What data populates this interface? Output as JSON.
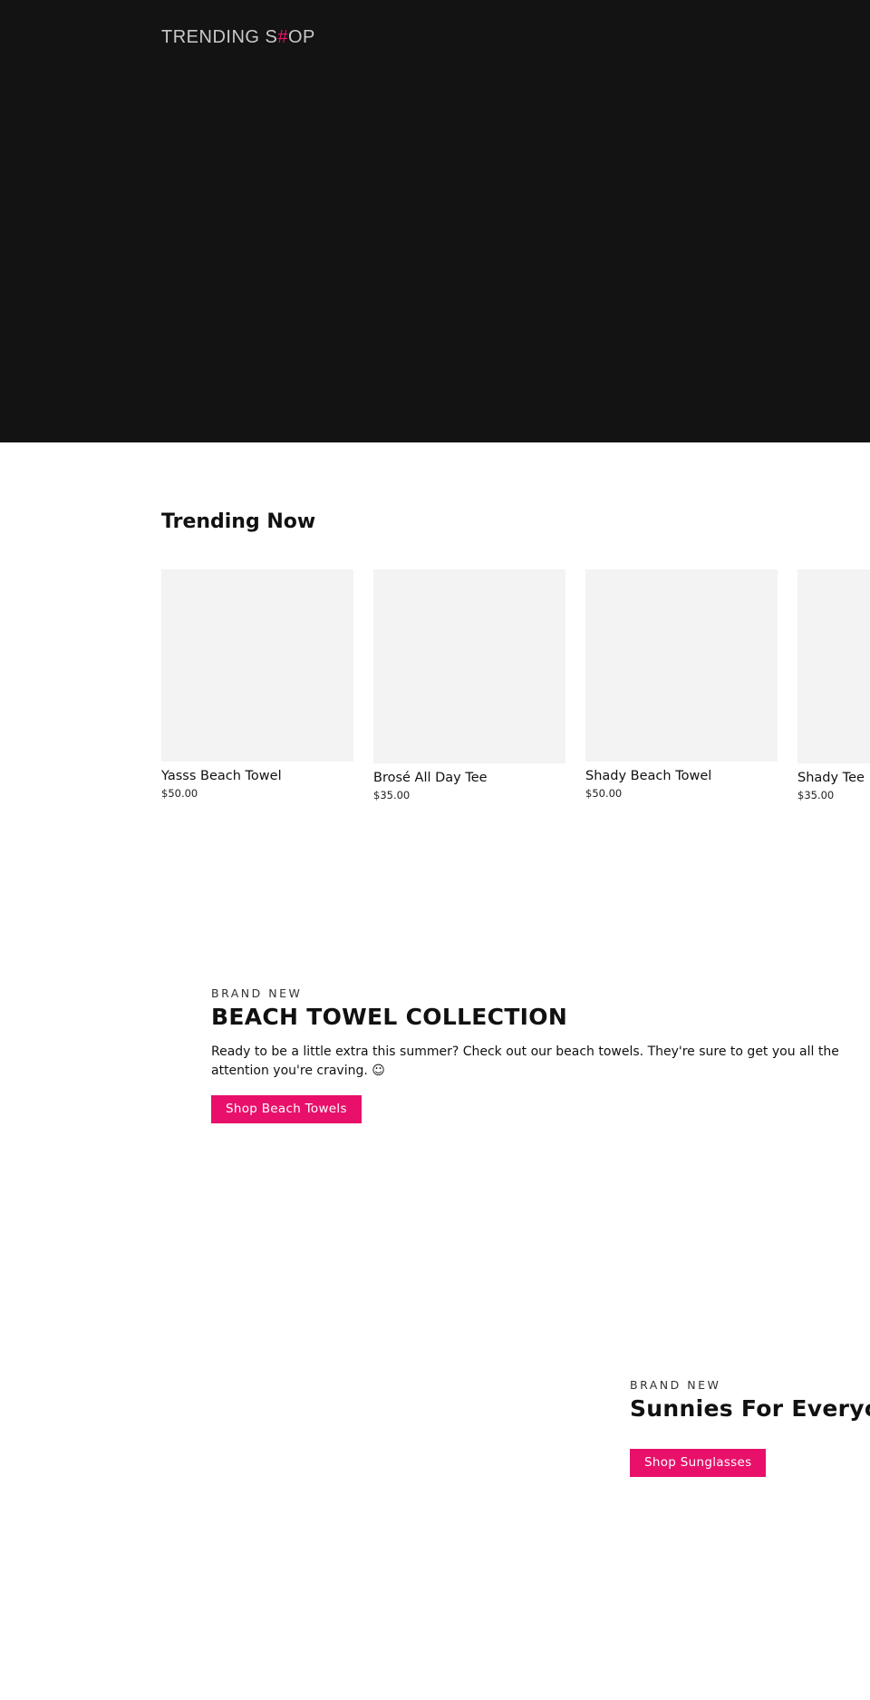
{
  "header": {
    "logo_prefix": "TRENDING S",
    "logo_hash": "#",
    "logo_suffix": "OP"
  },
  "trending": {
    "title": "Trending Now",
    "products": [
      {
        "name": "Yasss Beach Towel",
        "price": "$50.00"
      },
      {
        "name": "Brosé All Day Tee",
        "price": "$35.00"
      },
      {
        "name": "Shady Beach Towel",
        "price": "$50.00"
      },
      {
        "name": "Shady Tee",
        "price": "$35.00"
      }
    ]
  },
  "feature_towels": {
    "eyebrow": "BRAND NEW",
    "title": "BEACH TOWEL COLLECTION",
    "text": "Ready to be a little extra this summer? Check out our beach towels. They're sure to get you all the attention you're craving. ☺",
    "button": "Shop Beach Towels"
  },
  "feature_sunnies": {
    "eyebrow": "BRAND NEW",
    "title": "Sunnies For Everyo",
    "button": "Shop Sunglasses"
  },
  "colors": {
    "hero_bg": "#131313",
    "accent": "#e8106a",
    "placeholder": "#f3f3f3"
  }
}
